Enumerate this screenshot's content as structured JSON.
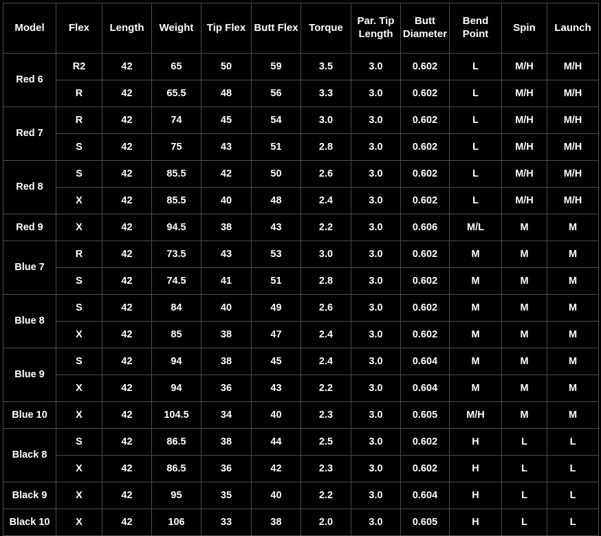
{
  "table": {
    "columns": [
      "Model",
      "Flex",
      "Length",
      "Weight",
      "Tip Flex",
      "Butt Flex",
      "Torque",
      "Par. Tip Length",
      "Butt Diameter",
      "Bend Point",
      "Spin",
      "Launch"
    ],
    "column_keys": [
      "model",
      "flex",
      "length",
      "weight",
      "tip_flex",
      "butt_flex",
      "torque",
      "par_tip_length",
      "butt_diameter",
      "bend_point",
      "spin",
      "launch"
    ],
    "groups": [
      {
        "model": "Red 6",
        "rows": [
          {
            "flex": "R2",
            "length": "42",
            "weight": "65",
            "tip_flex": "50",
            "butt_flex": "59",
            "torque": "3.5",
            "par_tip_length": "3.0",
            "butt_diameter": "0.602",
            "bend_point": "L",
            "spin": "M/H",
            "launch": "M/H"
          },
          {
            "flex": "R",
            "length": "42",
            "weight": "65.5",
            "tip_flex": "48",
            "butt_flex": "56",
            "torque": "3.3",
            "par_tip_length": "3.0",
            "butt_diameter": "0.602",
            "bend_point": "L",
            "spin": "M/H",
            "launch": "M/H"
          }
        ]
      },
      {
        "model": "Red 7",
        "rows": [
          {
            "flex": "R",
            "length": "42",
            "weight": "74",
            "tip_flex": "45",
            "butt_flex": "54",
            "torque": "3.0",
            "par_tip_length": "3.0",
            "butt_diameter": "0.602",
            "bend_point": "L",
            "spin": "M/H",
            "launch": "M/H"
          },
          {
            "flex": "S",
            "length": "42",
            "weight": "75",
            "tip_flex": "43",
            "butt_flex": "51",
            "torque": "2.8",
            "par_tip_length": "3.0",
            "butt_diameter": "0.602",
            "bend_point": "L",
            "spin": "M/H",
            "launch": "M/H"
          }
        ]
      },
      {
        "model": "Red 8",
        "rows": [
          {
            "flex": "S",
            "length": "42",
            "weight": "85.5",
            "tip_flex": "42",
            "butt_flex": "50",
            "torque": "2.6",
            "par_tip_length": "3.0",
            "butt_diameter": "0.602",
            "bend_point": "L",
            "spin": "M/H",
            "launch": "M/H"
          },
          {
            "flex": "X",
            "length": "42",
            "weight": "85.5",
            "tip_flex": "40",
            "butt_flex": "48",
            "torque": "2.4",
            "par_tip_length": "3.0",
            "butt_diameter": "0.602",
            "bend_point": "L",
            "spin": "M/H",
            "launch": "M/H"
          }
        ]
      },
      {
        "model": "Red 9",
        "rows": [
          {
            "flex": "X",
            "length": "42",
            "weight": "94.5",
            "tip_flex": "38",
            "butt_flex": "43",
            "torque": "2.2",
            "par_tip_length": "3.0",
            "butt_diameter": "0.606",
            "bend_point": "M/L",
            "spin": "M",
            "launch": "M"
          }
        ]
      },
      {
        "model": "Blue 7",
        "rows": [
          {
            "flex": "R",
            "length": "42",
            "weight": "73.5",
            "tip_flex": "43",
            "butt_flex": "53",
            "torque": "3.0",
            "par_tip_length": "3.0",
            "butt_diameter": "0.602",
            "bend_point": "M",
            "spin": "M",
            "launch": "M"
          },
          {
            "flex": "S",
            "length": "42",
            "weight": "74.5",
            "tip_flex": "41",
            "butt_flex": "51",
            "torque": "2.8",
            "par_tip_length": "3.0",
            "butt_diameter": "0.602",
            "bend_point": "M",
            "spin": "M",
            "launch": "M"
          }
        ]
      },
      {
        "model": "Blue 8",
        "rows": [
          {
            "flex": "S",
            "length": "42",
            "weight": "84",
            "tip_flex": "40",
            "butt_flex": "49",
            "torque": "2.6",
            "par_tip_length": "3.0",
            "butt_diameter": "0.602",
            "bend_point": "M",
            "spin": "M",
            "launch": "M"
          },
          {
            "flex": "X",
            "length": "42",
            "weight": "85",
            "tip_flex": "38",
            "butt_flex": "47",
            "torque": "2.4",
            "par_tip_length": "3.0",
            "butt_diameter": "0.602",
            "bend_point": "M",
            "spin": "M",
            "launch": "M"
          }
        ]
      },
      {
        "model": "Blue 9",
        "rows": [
          {
            "flex": "S",
            "length": "42",
            "weight": "94",
            "tip_flex": "38",
            "butt_flex": "45",
            "torque": "2.4",
            "par_tip_length": "3.0",
            "butt_diameter": "0.604",
            "bend_point": "M",
            "spin": "M",
            "launch": "M"
          },
          {
            "flex": "X",
            "length": "42",
            "weight": "94",
            "tip_flex": "36",
            "butt_flex": "43",
            "torque": "2.2",
            "par_tip_length": "3.0",
            "butt_diameter": "0.604",
            "bend_point": "M",
            "spin": "M",
            "launch": "M"
          }
        ]
      },
      {
        "model": "Blue 10",
        "rows": [
          {
            "flex": "X",
            "length": "42",
            "weight": "104.5",
            "tip_flex": "34",
            "butt_flex": "40",
            "torque": "2.3",
            "par_tip_length": "3.0",
            "butt_diameter": "0.605",
            "bend_point": "M/H",
            "spin": "M",
            "launch": "M"
          }
        ]
      },
      {
        "model": "Black 8",
        "rows": [
          {
            "flex": "S",
            "length": "42",
            "weight": "86.5",
            "tip_flex": "38",
            "butt_flex": "44",
            "torque": "2.5",
            "par_tip_length": "3.0",
            "butt_diameter": "0.602",
            "bend_point": "H",
            "spin": "L",
            "launch": "L"
          },
          {
            "flex": "X",
            "length": "42",
            "weight": "86.5",
            "tip_flex": "36",
            "butt_flex": "42",
            "torque": "2.3",
            "par_tip_length": "3.0",
            "butt_diameter": "0.602",
            "bend_point": "H",
            "spin": "L",
            "launch": "L"
          }
        ]
      },
      {
        "model": "Black 9",
        "rows": [
          {
            "flex": "X",
            "length": "42",
            "weight": "95",
            "tip_flex": "35",
            "butt_flex": "40",
            "torque": "2.2",
            "par_tip_length": "3.0",
            "butt_diameter": "0.604",
            "bend_point": "H",
            "spin": "L",
            "launch": "L"
          }
        ]
      },
      {
        "model": "Black 10",
        "rows": [
          {
            "flex": "X",
            "length": "42",
            "weight": "106",
            "tip_flex": "33",
            "butt_flex": "38",
            "torque": "2.0",
            "par_tip_length": "3.0",
            "butt_diameter": "0.605",
            "bend_point": "H",
            "spin": "L",
            "launch": "L"
          }
        ]
      }
    ]
  },
  "colors": {
    "background": "#000000",
    "text": "#ffffff",
    "gridline": "#4e4e4e"
  }
}
